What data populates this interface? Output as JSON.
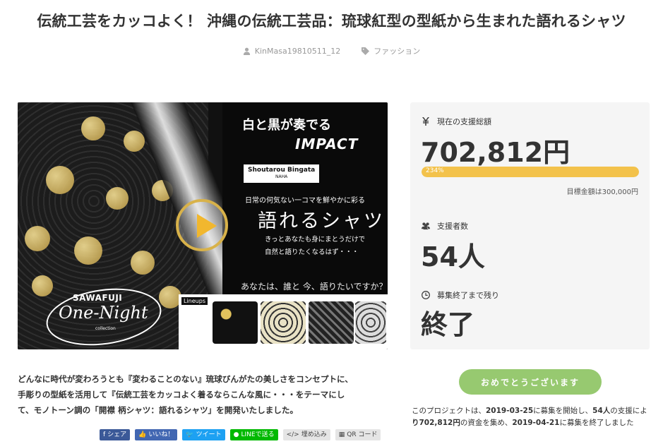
{
  "title": "伝統工芸をカッコよく！ 沖縄の伝統工芸品：琉球紅型の型紙から生まれた語れるシャツ",
  "meta": {
    "author": "KinMasa19810511_12",
    "author_icon": "user-icon",
    "category": "ファッション",
    "category_icon": "tag-icon"
  },
  "hero_image": {
    "headline_white": "白と黒が奏でる",
    "impact": "IMPACT",
    "brand": "Shoutarou Bingata",
    "brand_sub": "NAHA",
    "line1": "日常の何気ない一コマを鮮やかに彩る",
    "big": "語れるシャツ",
    "sub1": "きっとあなたも身にまとうだけで",
    "sub2": "自然と語りたくなるはず・・・",
    "question": "あなたは、誰と 今、語りたいですか？",
    "lineups": "Lineups",
    "sawafuji": "SAWAFUJI",
    "one_night": "One-Night",
    "collection": "collection",
    "play_icon": "play-icon"
  },
  "stats": {
    "funded_label": "現在の支援総額",
    "funded_icon": "yen-icon",
    "funded_value": "702,812円",
    "progress_pct": 234,
    "progress_label": "234%",
    "goal": "目標金額は300,000円",
    "supporters_label": "支援者数",
    "supporters_icon": "users-icon",
    "supporters_value": "54人",
    "remaining_label": "募集終了まで残り",
    "remaining_icon": "clock-icon",
    "remaining_value": "終了"
  },
  "description": {
    "line1": "どんなに時代が変わろうとも『変わることのない』琉球びんがたの美しさをコンセプトに、",
    "line2": "手彫りの型紙を活用して『伝統工芸をカッコよく着るならこんな風に・・・をテーマにし",
    "line3": "て、モノトーン調の「開襟 柄シャツ：語れるシャツ」を開発いたしました。"
  },
  "share": {
    "facebook": "シェア",
    "like": "いいね！",
    "tweet": "ツイート",
    "line": "LINEで送る",
    "embed": "埋め込み",
    "qr": "QR コード"
  },
  "congrats_button": "おめでとうございます",
  "result": {
    "p1": "このプロジェクトは、",
    "start_date": "2019-03-25",
    "p2": "に募集を開始し、",
    "supporters": "54人",
    "p3": "の支援によ",
    "amount": "り702,812円",
    "p4": "の資金を集め、",
    "end_date": "2019-04-21",
    "p5": "に募集を終了しました"
  }
}
